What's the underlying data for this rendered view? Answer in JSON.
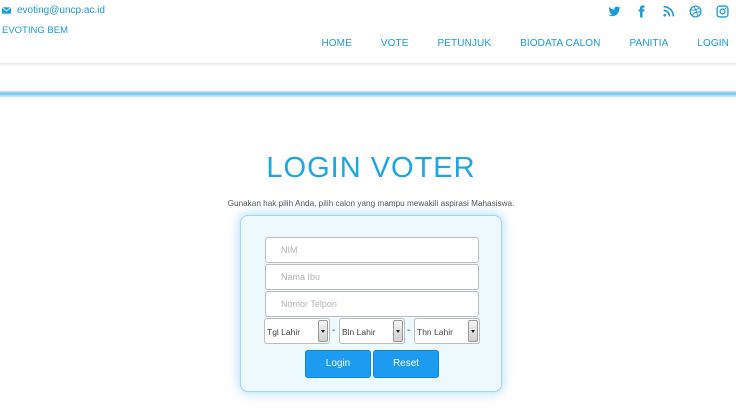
{
  "header": {
    "email": "evoting@uncp.ac.id",
    "brand": "EVOTING BEM",
    "social": [
      "twitter-icon",
      "facebook-icon",
      "rss-icon",
      "dribbble-icon",
      "instagram-icon"
    ],
    "nav": [
      "HOME",
      "VOTE",
      "PETUNJUK",
      "BIODATA CALON",
      "PANITIA",
      "LOGIN"
    ]
  },
  "main": {
    "title": "LOGIN VOTER",
    "subtitle": "Gunakan hak pilih Anda, pilih calon yang mampu mewakili aspirasi Mahasiswa."
  },
  "form": {
    "nim_placeholder": "NIM",
    "nim_value": "",
    "ibu_placeholder": "Nama Ibu",
    "ibu_value": "",
    "telpon_placeholder": "Nomor Telpon",
    "telpon_value": "",
    "tgl_selected": "Tgl Lahir",
    "bln_selected": "Bln Lahir",
    "thn_selected": "Thn Lahir",
    "separator": "-",
    "login_label": "Login",
    "reset_label": "Reset"
  },
  "colors": {
    "accent": "#1ba6e4",
    "button": "#1b9cf0",
    "panel_bg": "#eef9fd"
  }
}
